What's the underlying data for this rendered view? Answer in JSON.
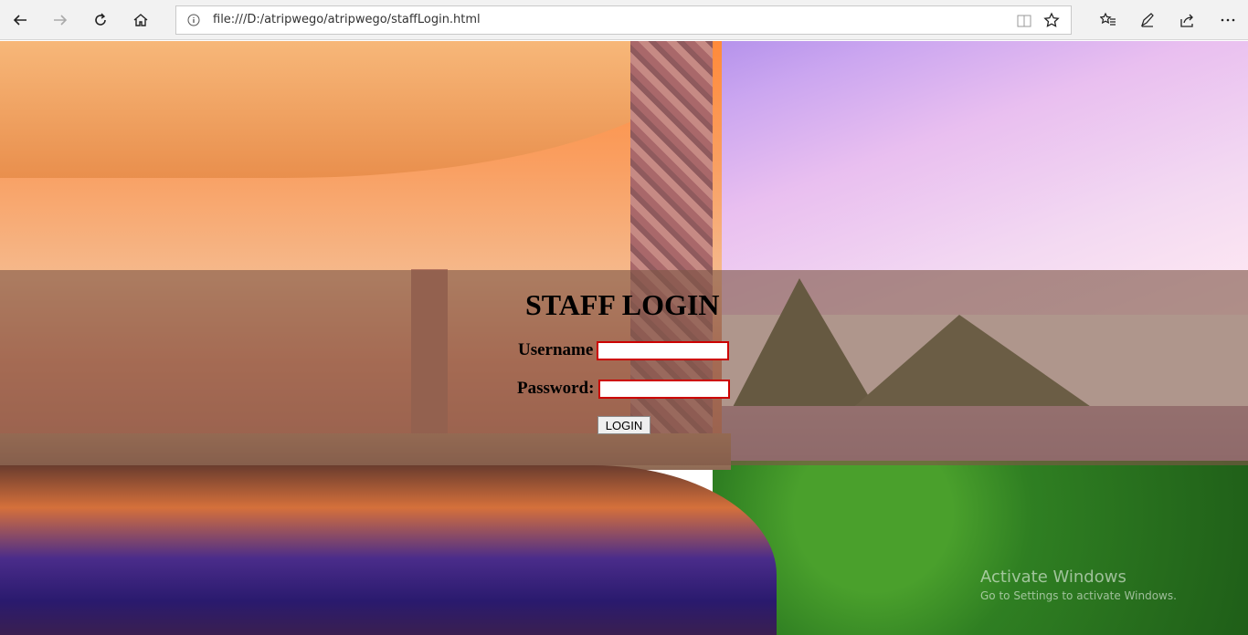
{
  "browser": {
    "url": "file:///D:/atripwego/atripwego/staffLogin.html",
    "icons": [
      "back-icon",
      "forward-icon",
      "refresh-icon",
      "home-icon",
      "info-icon",
      "reading-view-icon",
      "favorite-star-icon",
      "favorites-icon",
      "pen-icon",
      "share-icon",
      "more-icon"
    ]
  },
  "login": {
    "title": "STAFF LOGIN",
    "username_label": "Username",
    "password_label": "Password:",
    "username_value": "",
    "password_value": "",
    "button_label": "LOGIN"
  },
  "watermark": {
    "line1": "Activate Windows",
    "line2": "Go to Settings to activate Windows."
  },
  "colors": {
    "band": "#7e5646",
    "field_border": "#cc0000"
  }
}
